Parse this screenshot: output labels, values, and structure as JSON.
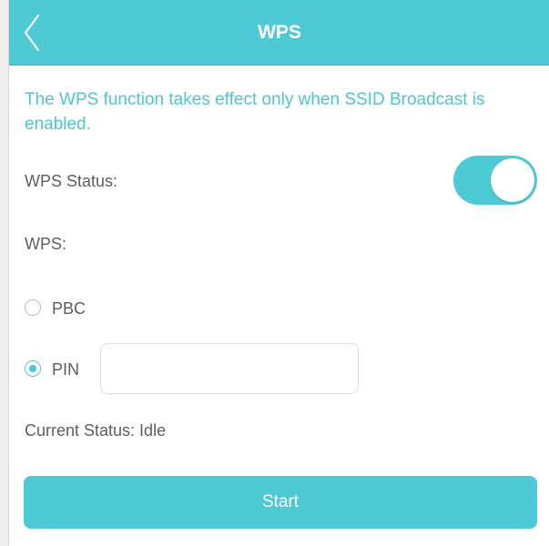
{
  "header": {
    "title": "WPS",
    "back_icon": "chevron-left-icon"
  },
  "notice": "The WPS function takes effect only when SSID Broadcast is enabled.",
  "wps_status": {
    "label": "WPS Status:",
    "enabled": true
  },
  "wps": {
    "label": "WPS:",
    "options": [
      {
        "label": "PBC",
        "selected": false
      },
      {
        "label": "PIN",
        "selected": true
      }
    ],
    "pin_value": ""
  },
  "current_status": "Current Status: Idle",
  "start_label": "Start",
  "colors": {
    "accent": "#4ecad6",
    "text": "#5e5e5e",
    "notice": "#4ec6d2"
  }
}
